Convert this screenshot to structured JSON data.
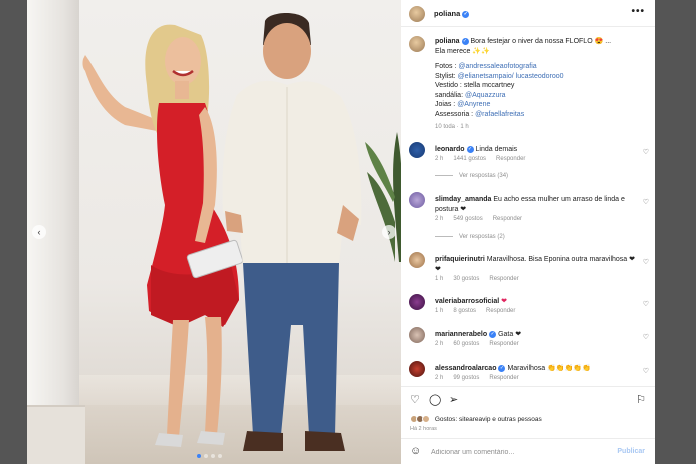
{
  "post": {
    "username": "poliana",
    "more_label": "•••",
    "caption": {
      "username": "poliana",
      "line1": "Bora festejar o niver da nossa FLOFLO 😍 ...",
      "line2": "Ela merece ✨✨",
      "credits": [
        {
          "label": "Fotos :",
          "value": "@andressaleaofotografia"
        },
        {
          "label": "Stylist:",
          "value": "@elianetsampaio/ lucasteodoroo0"
        },
        {
          "label": "Vestido :",
          "value": "stella mccartney"
        },
        {
          "label": "sandália:",
          "value": "@Aquazzura"
        },
        {
          "label": "Joias :",
          "value": "@Anyrene"
        },
        {
          "label": "Assessoria :",
          "value": "@rafaellafreitas"
        }
      ],
      "meta": "10 toda · 1 h"
    },
    "comments": [
      {
        "user": "leonardo",
        "verified": true,
        "text": "Linda demais",
        "time": "2 h",
        "likes": "1441 gostos",
        "reply": "Responder",
        "replies": "Ver respostas (34)"
      },
      {
        "user": "slimday_amanda",
        "verified": false,
        "text": "Eu acho essa mulher um arraso de linda e postura ❤",
        "time": "2 h",
        "likes": "549 gostos",
        "reply": "Responder",
        "replies": "Ver respostas (2)"
      },
      {
        "user": "prifaquierinutri",
        "verified": false,
        "text": "Maravilhosa. Bisa Eponina outra maravilhosa ❤ ❤",
        "time": "1 h",
        "likes": "30 gostos",
        "reply": "Responder"
      },
      {
        "user": "valeriabarrosoficial",
        "verified": true,
        "text": "❤",
        "time": "1 h",
        "likes": "8 gostos",
        "reply": "Responder"
      },
      {
        "user": "mariannerabelo",
        "verified": true,
        "text": "Gata ❤",
        "time": "2 h",
        "likes": "60 gostos",
        "reply": "Responder"
      },
      {
        "user": "alessandroalarcao",
        "verified": true,
        "text": "Maravilhosa 👏👏👏👏👏",
        "time": "2 h",
        "likes": "99 gostos",
        "reply": "Responder"
      }
    ],
    "likes_text": "Gostos: siteareavip e outras pessoas",
    "time_ago": "Há 2 horas",
    "comment_placeholder": "Adicionar um comentário...",
    "publish_label": "Publicar",
    "icons": {
      "like": "heart-icon",
      "comment": "comment-icon",
      "share": "send-icon",
      "save": "bookmark-icon",
      "emoji": "smile-icon"
    }
  }
}
